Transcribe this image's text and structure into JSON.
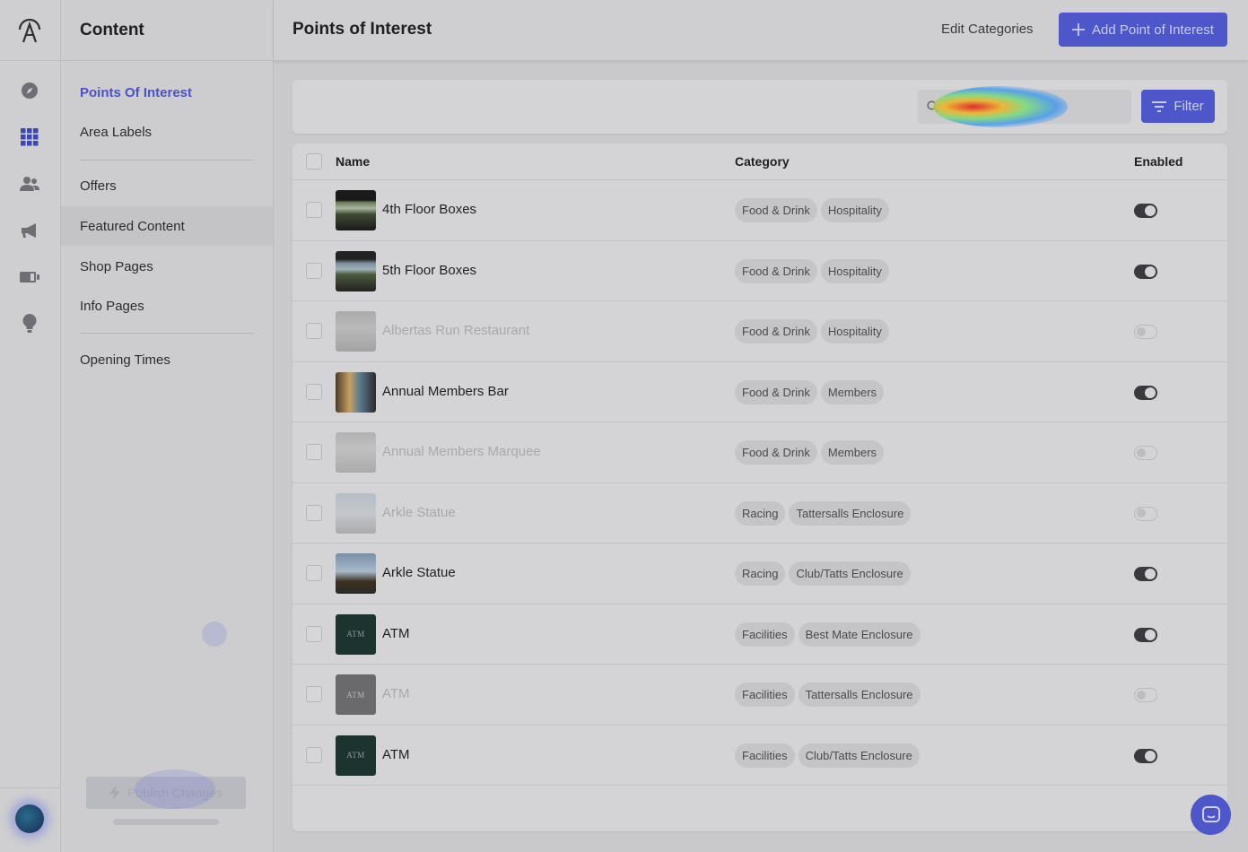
{
  "rail": {
    "icons": [
      "explore-icon",
      "grid-icon",
      "users-icon",
      "megaphone-icon",
      "battery-icon",
      "lightbulb-icon"
    ]
  },
  "subnav": {
    "title": "Content",
    "items": [
      {
        "label": "Points Of Interest",
        "active": true
      },
      {
        "label": "Area Labels"
      },
      {
        "label": "Offers"
      },
      {
        "label": "Featured Content"
      },
      {
        "label": "Shop Pages"
      },
      {
        "label": "Info Pages"
      },
      {
        "label": "Opening Times"
      }
    ],
    "publish_label": "Publish Changes"
  },
  "header": {
    "title": "Points of Interest",
    "edit_categories": "Edit Categories",
    "add_button": "Add Point of Interest"
  },
  "search": {
    "placeholder": "",
    "filter_label": "Filter"
  },
  "table": {
    "columns": {
      "name": "Name",
      "category": "Category",
      "enabled": "Enabled"
    },
    "rows": [
      {
        "name": "4th Floor Boxes",
        "tags": [
          "Food & Drink",
          "Hospitality"
        ],
        "enabled": true,
        "thumb": "photo"
      },
      {
        "name": "5th Floor Boxes",
        "tags": [
          "Food & Drink",
          "Hospitality"
        ],
        "enabled": true,
        "thumb": "photo"
      },
      {
        "name": "Albertas Run Restaurant",
        "tags": [
          "Food & Drink",
          "Hospitality"
        ],
        "enabled": false,
        "thumb": "photo"
      },
      {
        "name": "Annual Members Bar",
        "tags": [
          "Food & Drink",
          "Members"
        ],
        "enabled": true,
        "thumb": "photo"
      },
      {
        "name": "Annual Members Marquee",
        "tags": [
          "Food & Drink",
          "Members"
        ],
        "enabled": false,
        "thumb": "photo"
      },
      {
        "name": "Arkle Statue",
        "tags": [
          "Racing",
          "Tattersalls Enclosure"
        ],
        "enabled": false,
        "thumb": "photo"
      },
      {
        "name": "Arkle Statue",
        "tags": [
          "Racing",
          "Club/Tatts Enclosure"
        ],
        "enabled": true,
        "thumb": "photo"
      },
      {
        "name": "ATM",
        "tags": [
          "Facilities",
          "Best Mate Enclosure"
        ],
        "enabled": true,
        "thumb": "atm"
      },
      {
        "name": "ATM",
        "tags": [
          "Facilities",
          "Tattersalls Enclosure"
        ],
        "enabled": false,
        "thumb": "atm"
      },
      {
        "name": "ATM",
        "tags": [
          "Facilities",
          "Club/Tatts Enclosure"
        ],
        "enabled": true,
        "thumb": "atm"
      }
    ],
    "atm_thumb_text": "ATM"
  },
  "colors": {
    "accent": "#4d57c9",
    "active_nav": "#4a52c8"
  }
}
